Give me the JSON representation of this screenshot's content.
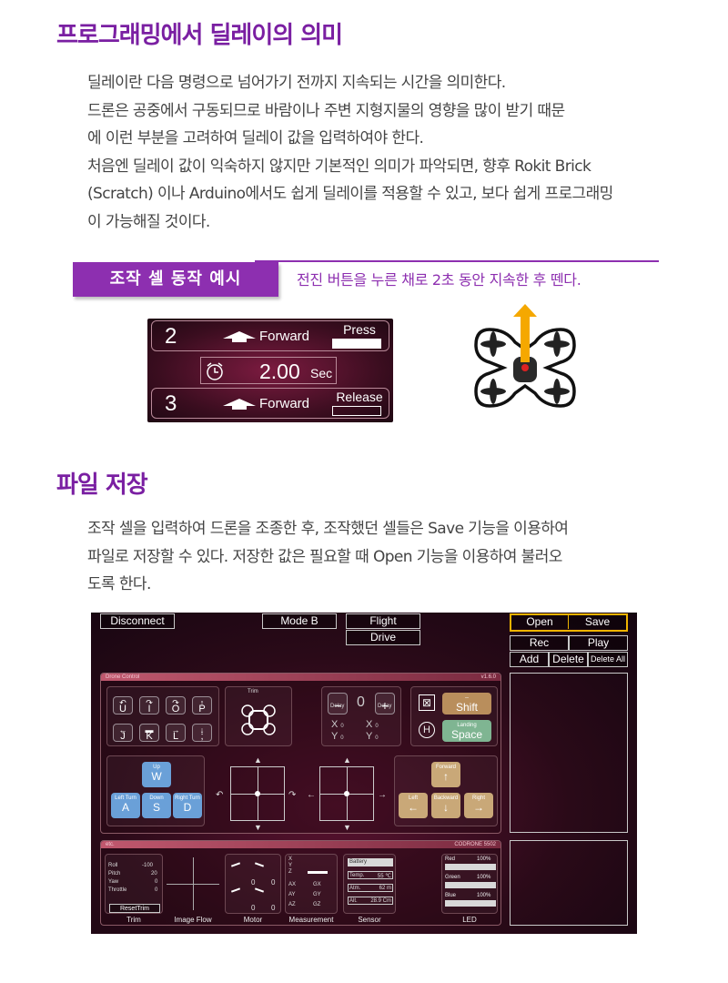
{
  "section1": {
    "title": "프로그래밍에서 딜레이의 의미",
    "lines": [
      "딜레이란 다음 명령으로 넘어가기 전까지 지속되는 시간을 의미한다.",
      "드론은 공중에서 구동되므로 바람이나 주변 지형지물의 영향을 많이 받기 때문",
      "에 이런 부분을 고려하여 딜레이 값을 입력하여야 한다.",
      "처음엔 딜레이 값이 익숙하지 않지만 기본적인 의미가 파악되면, 향후 Rokit Brick",
      "(Scratch) 이나 Arduino에서도 쉽게 딜레이를 적용할 수 있고, 보다 쉽게 프로그래밍",
      "이 가능해질 것이다."
    ]
  },
  "example": {
    "label": "조작 셀 동작 예시",
    "caption": "전진 버튼을 누른 채로 2초 동안 지속한 후 뗀다."
  },
  "cell": {
    "row1": {
      "num": "2",
      "direction": "Forward",
      "action": "Press"
    },
    "timer": {
      "value": "2.00",
      "unit": "Sec"
    },
    "row2": {
      "num": "3",
      "direction": "Forward",
      "action": "Release"
    }
  },
  "section2": {
    "title": "파일 저장",
    "lines": [
      "조작 셀을 입력하여 드론을 조종한 후, 조작했던 셀들은 Save 기능을 이용하여",
      "파일로 저장할 수 있다. 저장한 값은 필요할 때 Open 기능을 이용하여 불러오",
      "도록 한다."
    ]
  },
  "app": {
    "disconnect": "Disconnect",
    "mode": "Mode B",
    "flight": "Flight",
    "drive": "Drive",
    "open": "Open",
    "save": "Save",
    "rec": "Rec",
    "play": "Play",
    "add": "Add",
    "delete": "Delete",
    "delete_all": "Delete All",
    "panel1_title": "Drone Control",
    "panel1_version": "v1.6.0",
    "trim": "Trim",
    "delay_minus": "Delay",
    "delay_plus": "Delay",
    "delay_value": "0",
    "xy": {
      "x1": "X",
      "y1": "Y",
      "x1v": "0",
      "y1v": "0",
      "x2": "X",
      "y2": "Y",
      "x2v": "0",
      "y2v": "0"
    },
    "keys_top": [
      "U",
      "I",
      "O",
      "P"
    ],
    "keys_bottom": [
      "J",
      "K",
      "L",
      ";"
    ],
    "shift": {
      "top": "--",
      "key": "Shift"
    },
    "landing": {
      "top": "Landing",
      "key": "Space"
    },
    "left_keys": {
      "up": {
        "t": "Up",
        "k": "W"
      },
      "left": {
        "t": "Left Turn",
        "k": "A"
      },
      "down": {
        "t": "Down",
        "k": "S"
      },
      "right": {
        "t": "Right Turn",
        "k": "D"
      }
    },
    "right_keys": {
      "forward": "Forward",
      "left": "Left",
      "backward": "Backward",
      "right": "Right"
    },
    "panel2_title": "etc.",
    "panel2_device": "CODRONE 5502",
    "trim_vals": [
      {
        "k": "Roll",
        "v": "-100"
      },
      {
        "k": "Pitch",
        "v": "20"
      },
      {
        "k": "Yaw",
        "v": "0"
      },
      {
        "k": "Throttle",
        "v": "0"
      }
    ],
    "reset_trim": "ResetTrim",
    "motor_vals": [
      "0",
      "0",
      "0",
      "0"
    ],
    "measure": {
      "x": "X",
      "y": "Y",
      "z": "Z",
      "ax": "AX",
      "ay": "AY",
      "az": "AZ",
      "gx": "GX",
      "gy": "GY",
      "gz": "GZ"
    },
    "sensor": {
      "battery": "Battery",
      "temp_k": "Temp.",
      "temp_v": "55 ℃",
      "atm_k": "Atm.",
      "atm_v": "62 m",
      "alt_k": "Alt.",
      "alt_v": "28.9 Cm"
    },
    "led": {
      "red_k": "Red",
      "red_v": "100%",
      "green_k": "Green",
      "green_v": "100%",
      "blue_k": "Blue",
      "blue_v": "100%"
    },
    "labels": {
      "trim": "Trim",
      "image_flow": "Image Flow",
      "motor": "Motor",
      "measurement": "Measurement",
      "sensor": "Sensor",
      "led": "LED"
    }
  }
}
